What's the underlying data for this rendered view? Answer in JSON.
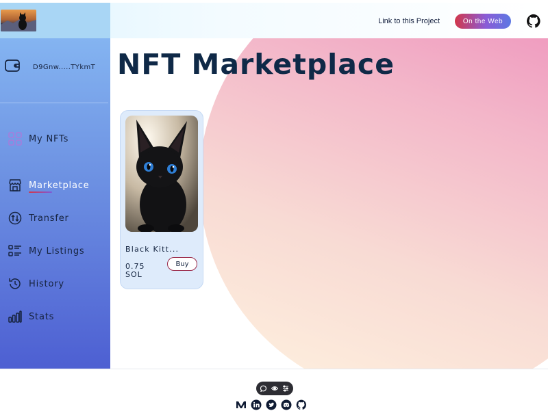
{
  "header": {
    "project_link": "Link to this Project",
    "web_button": "On the Web",
    "github_icon": "github-icon",
    "logo_icon": "cat-logo"
  },
  "sidebar": {
    "wallet_icon": "wallet-icon",
    "wallet_address": "D9Gnw.....TYkmT",
    "items": [
      {
        "label": "My NFTs",
        "icon": "grid-icon"
      },
      {
        "label": "Marketplace",
        "icon": "store-icon",
        "active": true
      },
      {
        "label": "Transfer",
        "icon": "transfer-icon"
      },
      {
        "label": "My Listings",
        "icon": "list-icon"
      },
      {
        "label": "History",
        "icon": "history-icon"
      },
      {
        "label": "Stats",
        "icon": "stats-icon"
      }
    ]
  },
  "main": {
    "title": "NFT Marketplace",
    "cards": [
      {
        "name": "Black Kitt...",
        "price_line1": "0.75",
        "price_line2": "SOL",
        "buy_label": "Buy",
        "image": "black-kitten-image"
      }
    ]
  },
  "footer": {
    "toolbar_icons": [
      "chat-icon",
      "eye-icon",
      "sliders-icon"
    ],
    "socials": [
      "medium-icon",
      "linkedin-icon",
      "twitter-icon",
      "discord-icon",
      "github-icon"
    ]
  },
  "colors": {
    "accent_gradient_start": "#d2374b",
    "accent_gradient_end": "#5d78e3",
    "sidebar_top": "#84b4f1",
    "sidebar_bottom": "#4d5fd2",
    "title": "#0f2947"
  }
}
